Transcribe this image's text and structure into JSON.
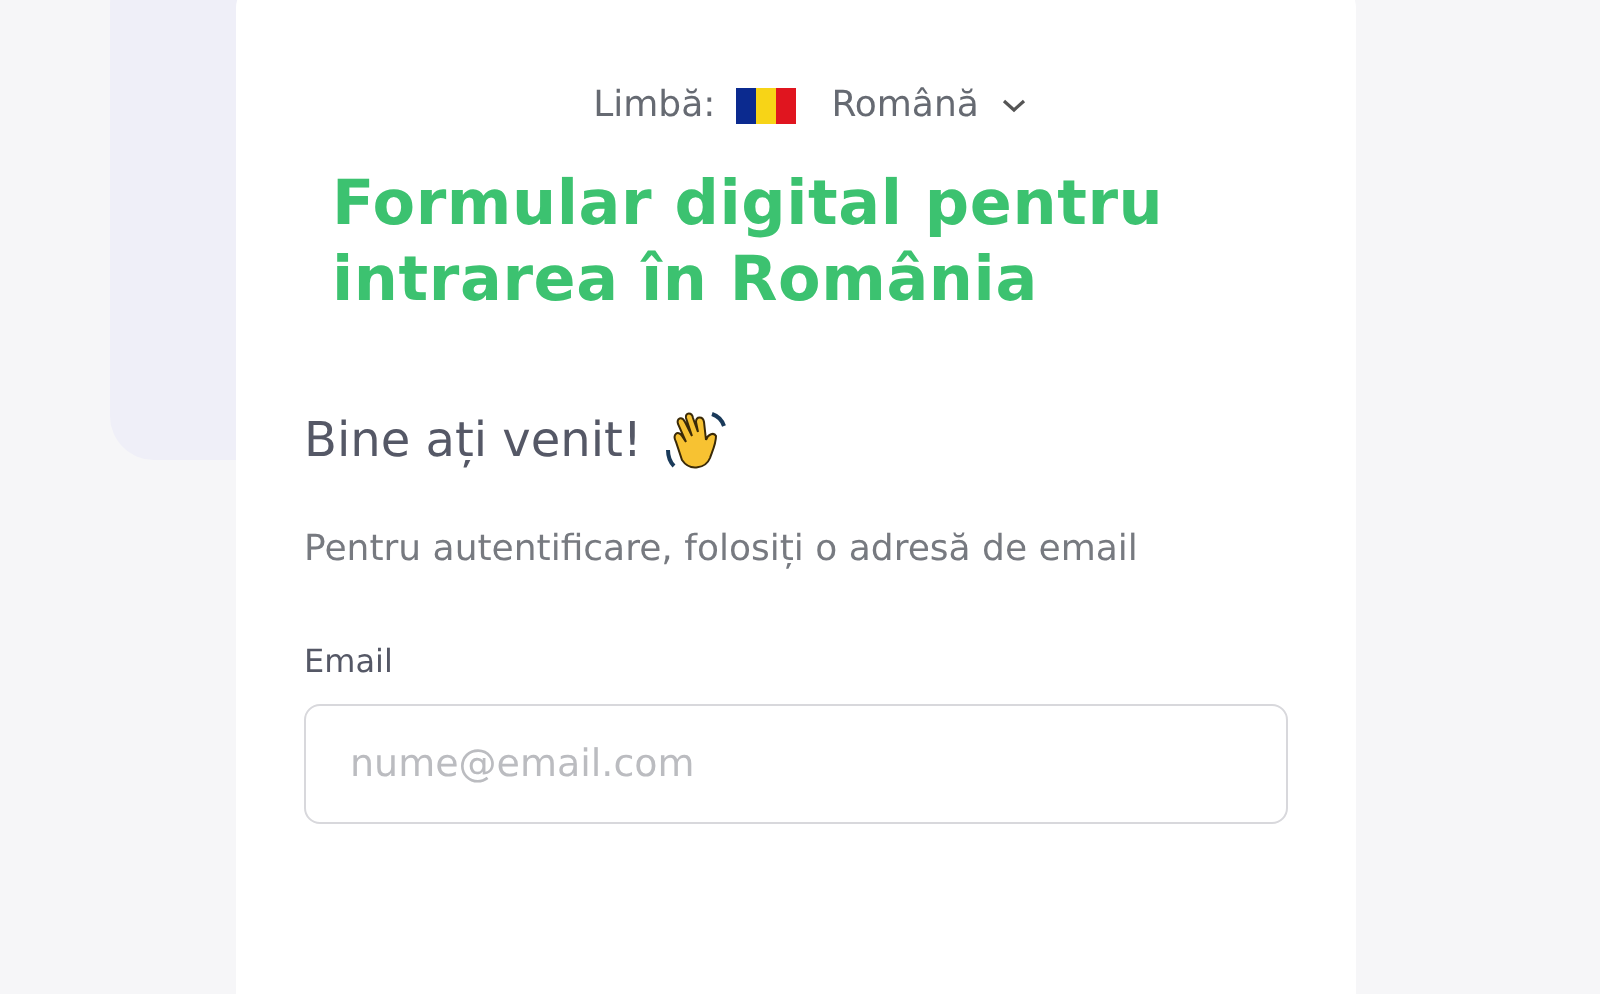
{
  "language_selector": {
    "label": "Limbă:",
    "value": "Română"
  },
  "title": "Formular digital pentru intrarea în România",
  "greeting": "Bine ați venit!",
  "instructions": "Pentru autentificare, folosiți o adresă de email",
  "email_field": {
    "label": "Email",
    "placeholder": "nume@email.com"
  }
}
